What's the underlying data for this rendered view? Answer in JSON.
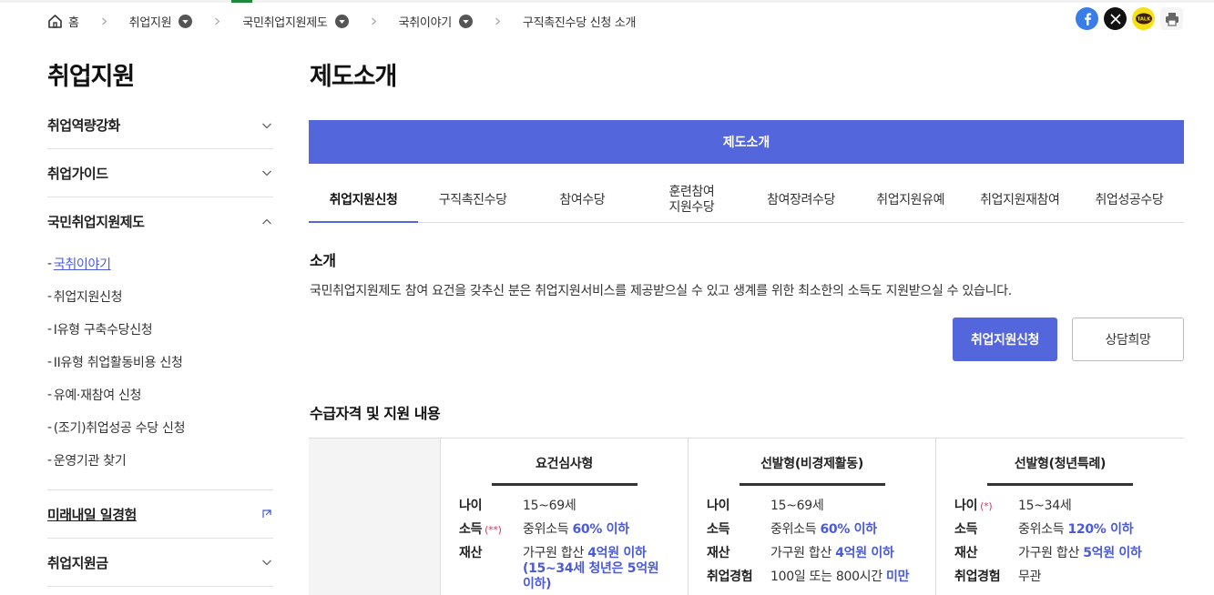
{
  "breadcrumb": {
    "home": "홈",
    "items": [
      "취업지원",
      "국민취업지원제도",
      "국취이야기"
    ],
    "current": "구직촉진수당 신청 소개"
  },
  "share": {
    "icons": [
      "facebook-icon",
      "x-icon",
      "kakaotalk-icon",
      "print-icon"
    ],
    "kakao_text": "TALK"
  },
  "sidebar": {
    "title": "취업지원",
    "menus": [
      {
        "label": "취업역량강화"
      },
      {
        "label": "취업가이드"
      },
      {
        "label": "국민취업지원제도"
      }
    ],
    "sub_items": [
      "국취이야기",
      "취업지원신청",
      "I유형 구축수당신청",
      "II유형 취업활동비용 신청",
      "유예·재참여 신청",
      "(조기)취업성공 수당 신청",
      "운영기관 찾기"
    ],
    "link_menu": "미래내일 일경험",
    "last_menu": "취업지원금"
  },
  "main": {
    "title": "제도소개",
    "banner": "제도소개",
    "tabs": [
      "취업지원신청",
      "구직촉진수당",
      "참여수당",
      "훈련참여\n지원수당",
      "참여장려수당",
      "취업지원유예",
      "취업지원재참여",
      "취업성공수당"
    ],
    "active_tab": 0,
    "intro_heading": "소개",
    "intro_text": "국민취업지원제도 참여 요건을 갖추신 분은 취업지원서비스를 제공받으실 수 있고 생계를 위한 최소한의 소득도 지원받으실 수 있습니다.",
    "apply_button": "취업지원신청",
    "consult_button": "상담희망",
    "qual_heading": "수급자격 및 지원 내용"
  },
  "table": {
    "columns": [
      {
        "title": "요건심사형",
        "rows": [
          {
            "key": "나이",
            "mark": "",
            "value": "15~69세",
            "hl": "",
            "tail": ""
          },
          {
            "key": "소득",
            "mark": "(**)",
            "value": "중위소득 ",
            "hl": "60% 이하",
            "tail": ""
          },
          {
            "key": "재산",
            "mark": "",
            "value": "가구원 합산 ",
            "hl": "4억원 이하 (15~34세 청년은 5억원 이하)",
            "tail": ""
          }
        ]
      },
      {
        "title": "선발형(비경제활동)",
        "rows": [
          {
            "key": "나이",
            "mark": "",
            "value": "15~69세",
            "hl": "",
            "tail": ""
          },
          {
            "key": "소득",
            "mark": "",
            "value": "중위소득 ",
            "hl": "60% 이하",
            "tail": ""
          },
          {
            "key": "재산",
            "mark": "",
            "value": "가구원 합산 ",
            "hl": "4억원 이하",
            "tail": ""
          },
          {
            "key": "취업경험",
            "mark": "",
            "value": "100일 또는 800시간 ",
            "hl": "미만",
            "tail": ""
          }
        ]
      },
      {
        "title": "선발형(청년특례)",
        "rows": [
          {
            "key": "나이",
            "mark": "(*)",
            "value": "15~34세",
            "hl": "",
            "tail": ""
          },
          {
            "key": "소득",
            "mark": "",
            "value": "중위소득 ",
            "hl": "120% 이하",
            "tail": ""
          },
          {
            "key": "재산",
            "mark": "",
            "value": "가구원 합산 ",
            "hl": "5억원 이하",
            "tail": ""
          },
          {
            "key": "취업경험",
            "mark": "",
            "value": "무관",
            "hl": "",
            "tail": ""
          }
        ]
      }
    ]
  },
  "colors": {
    "accent": "#5466db",
    "highlight": "#4a5ad8",
    "mark": "#d9365b"
  }
}
